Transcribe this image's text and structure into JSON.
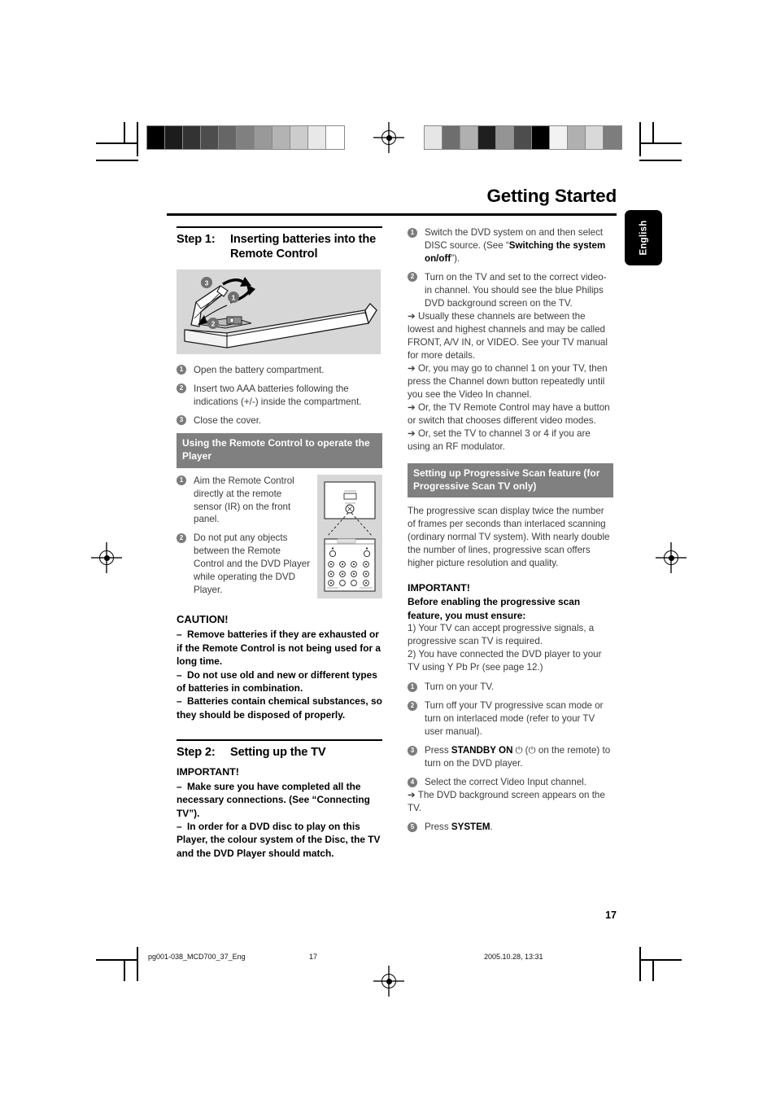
{
  "header": {
    "title": "Getting Started",
    "language_tab": "English"
  },
  "footer": {
    "page_number": "17",
    "file_name": "pg001-038_MCD700_37_Eng",
    "folio": "17",
    "timestamp": "2005.10.28, 13:31"
  },
  "calibration": {
    "left_bar_label": "grayscale-ramp",
    "left_bar_colors": [
      "#000000",
      "#1c1c1c",
      "#333333",
      "#4d4d4d",
      "#666666",
      "#808080",
      "#999999",
      "#b3b3b3",
      "#cccccc",
      "#e8e8e8",
      "#ffffff"
    ],
    "right_bar_label": "gray-patch-bar",
    "right_bar_colors": [
      "#e6e6e6",
      "#6e6e6e",
      "#b0b0b0",
      "#1f1f1f",
      "#949494",
      "#4d4d4d",
      "#000000",
      "#f2f2f2",
      "#b0b0b0",
      "#d9d9d9",
      "#7d7d7d"
    ]
  },
  "left_column": {
    "step1": {
      "label": "Step 1:",
      "title": "Inserting batteries into the Remote Control",
      "figure_name": "remote-control-battery-compartment",
      "figure_callouts": [
        "1",
        "2",
        "3"
      ]
    },
    "battery_steps": [
      {
        "n": "1",
        "text": "Open the battery compartment."
      },
      {
        "n": "2",
        "text": "Insert two AAA batteries following the indications (+/-) inside the compartment."
      },
      {
        "n": "3",
        "text": "Close the cover."
      }
    ],
    "using_remote_header": "Using the Remote Control to operate the Player",
    "using_remote_steps": [
      {
        "n": "1",
        "text": "Aim the Remote Control directly at the remote sensor (IR) on the front panel."
      },
      {
        "n": "2",
        "text": "Do not put any objects between the Remote Control and the DVD Player while operating the DVD Player."
      }
    ],
    "sensor_figure_name": "front-panel-ir-sensor-and-remote",
    "caution": {
      "title": "CAUTION!",
      "items": [
        "Remove batteries if they are exhausted or if the Remote Control is not being used for a long time.",
        "Do not use old and new or different types of batteries in combination.",
        "Batteries contain chemical substances, so they should be disposed of properly."
      ]
    },
    "step2": {
      "label": "Step 2:",
      "title": "Setting up the TV",
      "important_title": "IMPORTANT!",
      "important_items": [
        "Make sure you have completed all the necessary connections. (See “Connecting TV”).",
        "In order for a DVD disc to play on this Player, the colour system of the Disc, the TV and the DVD Player should match."
      ]
    }
  },
  "right_column": {
    "tv_steps": [
      {
        "n": "1",
        "text_a": "Switch the DVD system on and then select DISC source. (See “",
        "bold": "Switching the system on/off",
        "text_b": "”)."
      },
      {
        "n": "2",
        "text": "Turn on the TV and set to the correct video-in channel. You should see the blue Philips DVD background screen on the TV.",
        "subs": [
          "Usually these channels are between the lowest and highest channels and may be called FRONT, A/V IN, or VIDEO. See your TV manual for more details.",
          "Or, you may go to channel 1 on your TV, then press the Channel down button repeatedly until you see the Video In channel.",
          "Or, the TV Remote Control may have a button or switch that chooses different video modes.",
          "Or, set the TV to channel 3 or 4 if you are using an RF modulator."
        ]
      }
    ],
    "progressive_header": "Setting up Progressive Scan feature (for Progressive Scan TV only)",
    "progressive_body": "The progressive scan display twice the number of frames per seconds than interlaced scanning (ordinary normal TV system). With nearly double the number of lines, progressive scan offers higher picture resolution and quality.",
    "important_title": "IMPORTANT!",
    "important_lead": "Before enabling the progressive scan feature, you must ensure:",
    "important_items": [
      "1) Your TV can accept progressive signals, a progressive scan TV is required.",
      "2) You have connected the DVD player to your TV using Y Pb Pr (see page 12.)"
    ],
    "progressive_steps": [
      {
        "n": "1",
        "text": "Turn on your TV."
      },
      {
        "n": "2",
        "text": "Turn off your TV progressive scan mode or turn on interlaced mode (refer to your TV user manual)."
      },
      {
        "n": "3",
        "text_a": "Press ",
        "bold": "STANDBY ON",
        "power_symbol": "⏻",
        "text_b": " on the remote) to turn on the DVD player."
      },
      {
        "n": "4",
        "text": "Select the correct Video Input channel.",
        "sub": "The DVD background screen appears on the TV."
      },
      {
        "n": "5",
        "text_a": "Press ",
        "bold": "SYSTEM",
        "text_b": "."
      }
    ]
  },
  "icons": {
    "arrow": "➔",
    "registration_mark": "registration-target",
    "power": "⏻"
  }
}
